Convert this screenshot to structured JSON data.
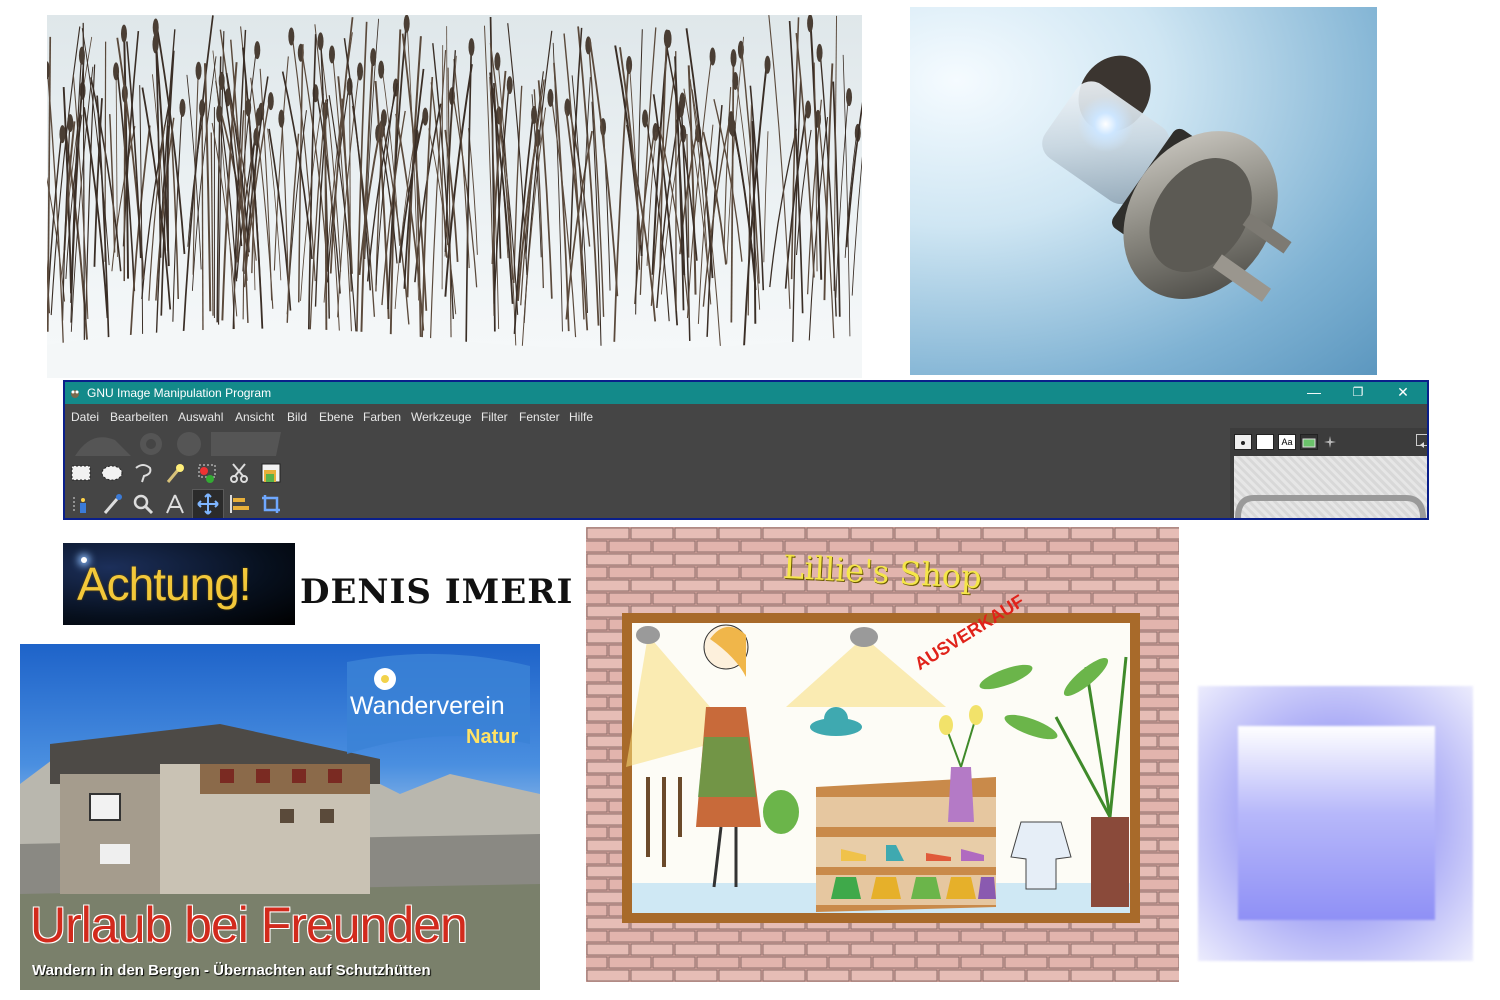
{
  "gimp": {
    "title": "GNU Image Manipulation Program",
    "window_buttons": {
      "minimize": "—",
      "restore": "❐",
      "close": "✕"
    },
    "menu": [
      "Datei",
      "Bearbeiten",
      "Auswahl",
      "Ansicht",
      "Bild",
      "Ebene",
      "Farben",
      "Werkzeuge",
      "Filter",
      "Fenster",
      "Hilfe"
    ],
    "tools_row1": [
      "rect-select-icon",
      "ellipse-select-icon",
      "free-select-icon",
      "fuzzy-select-icon",
      "select-by-color-icon",
      "scissors-select-icon",
      "foreground-select-icon"
    ],
    "tools_row2": [
      "paths-icon",
      "color-picker-icon",
      "zoom-icon",
      "measure-icon",
      "move-icon",
      "align-icon",
      "crop-icon"
    ],
    "dock_tabs": [
      "brushes-icon",
      "patterns-icon",
      "fonts-icon",
      "images-icon",
      "dynamics-icon"
    ],
    "dock_font_label": "Aa",
    "active_tool": "move-icon"
  },
  "achtung": {
    "text": "Achtung!"
  },
  "denis": {
    "text": "DENIS IMERI"
  },
  "hike": {
    "badge_line1": "Wanderverein",
    "badge_line2": "Natur",
    "headline": "Urlaub bei Freunden",
    "subline": "Wandern in den Bergen - Übernachten auf Schutzhütten"
  },
  "shop": {
    "title": "Lillie's Shop",
    "sale": "AUSVERKAUF"
  },
  "colors": {
    "gimp_titlebar": "#138a8a",
    "gimp_border": "#0a1f8a",
    "achtung_text": "#f3c83a",
    "headline_red": "#d22a1c",
    "blue_square": "#8b8bf4"
  }
}
